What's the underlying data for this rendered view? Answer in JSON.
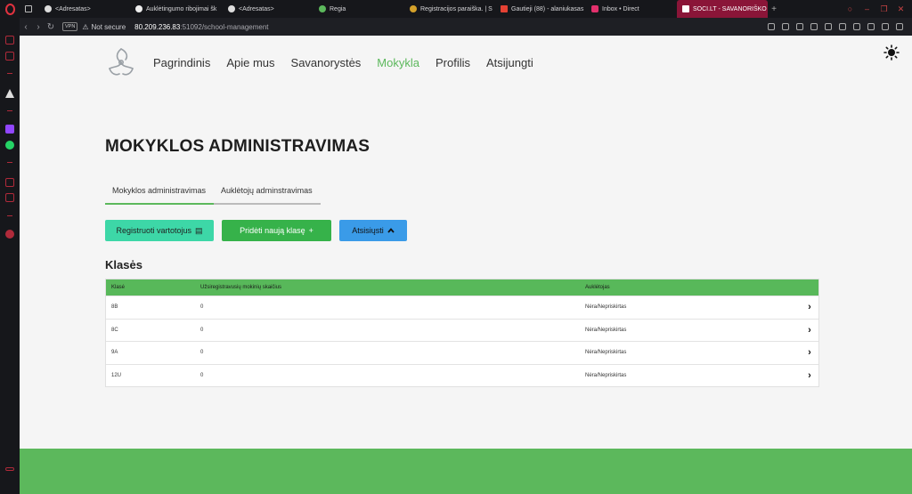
{
  "browser": {
    "tabs": [
      {
        "label": "",
        "color": "#bbbbbb"
      },
      {
        "label": "<Adresatas>",
        "color": "#dddddd"
      },
      {
        "label": "Auklėtingumo ribojimai šk",
        "color": "#eeeeee"
      },
      {
        "label": "<Adresatas>",
        "color": "#dddddd"
      },
      {
        "label": "Regia",
        "color": "#5cb85c"
      },
      {
        "label": "Registracijos paraiška. | S",
        "color": "#d4a12a"
      },
      {
        "label": "Gautieji (88) - alaniukasas",
        "color": "#e44133"
      },
      {
        "label": "Inbox • Direct",
        "color": "#e1306c"
      },
      {
        "label": "SOCI.LT - SAVANORIŠKO",
        "color": "#ffffff"
      }
    ],
    "vpn_label": "VPN",
    "not_secure": "Not secure",
    "url_host": "80.209.236.83",
    "url_path": ":51092/school-management"
  },
  "nav": {
    "items": [
      "Pagrindinis",
      "Apie mus",
      "Savanorystės",
      "Mokykla",
      "Profilis",
      "Atsijungti"
    ],
    "active_index": 3
  },
  "page": {
    "title": "MOKYKLOS ADMINISTRAVIMAS",
    "tabs": [
      "Mokyklos administravimas",
      "Auklėtojų adminstravimas"
    ],
    "active_tab": 0,
    "buttons": {
      "register": "Registruoti vartotojus",
      "add_class": "Pridėti naują klasę",
      "download": "Atsisiųsti"
    },
    "section_title": "Klasės"
  },
  "table": {
    "headers": [
      "Klasė",
      "Užsiregistravusių mokinių skaičius",
      "Auklėtojas"
    ],
    "rows": [
      {
        "class": "8B",
        "count": "0",
        "teacher": "Nėra/Nepriskirtas"
      },
      {
        "class": "8C",
        "count": "0",
        "teacher": "Nėra/Nepriskirtas"
      },
      {
        "class": "9A",
        "count": "0",
        "teacher": "Nėra/Nepriskirtas"
      },
      {
        "class": "12U",
        "count": "0",
        "teacher": "Nėra/Nepriskirtas"
      }
    ]
  },
  "colors": {
    "accent": "#5cb85c",
    "tab_active": "#8a1538"
  }
}
